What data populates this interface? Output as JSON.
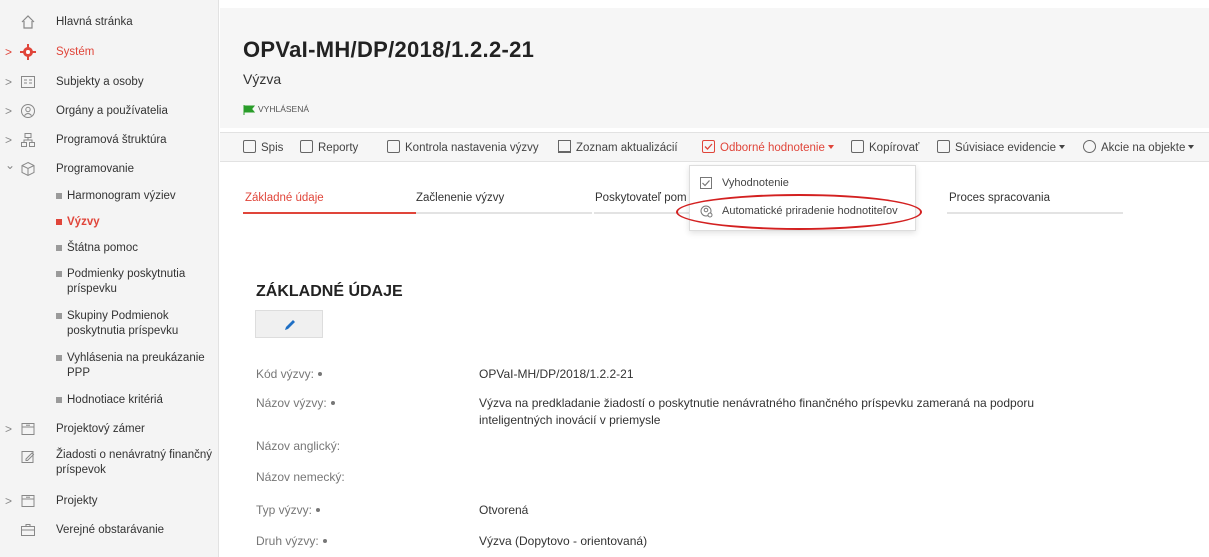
{
  "sidebar": {
    "items": [
      {
        "label": "Hlavná stránka",
        "chevron": "",
        "icon": "home-icon"
      },
      {
        "label": "Systém",
        "chevron": ">",
        "icon": "gear-icon"
      },
      {
        "label": "Subjekty a osoby",
        "chevron": ">",
        "icon": "id-card-icon"
      },
      {
        "label": "Orgány a používatelia",
        "chevron": ">",
        "icon": "user-circle-icon"
      },
      {
        "label": "Programová štruktúra",
        "chevron": ">",
        "icon": "hierarchy-icon"
      },
      {
        "label": "Programovanie",
        "chevron": "⌄",
        "icon": "cube-icon"
      },
      {
        "label": "Projektový zámer",
        "chevron": ">",
        "icon": "folder-icon"
      },
      {
        "label": "Žiadosti o nenávratný finančný príspevok",
        "chevron": "",
        "icon": "edit-doc-icon"
      },
      {
        "label": "Projekty",
        "chevron": ">",
        "icon": "folder-icon"
      },
      {
        "label": "Verejné obstarávanie",
        "chevron": "",
        "icon": "briefcase-icon"
      }
    ],
    "subitems": [
      {
        "label": "Harmonogram výziev"
      },
      {
        "label": "Výzvy"
      },
      {
        "label": "Štátna pomoc"
      },
      {
        "label": "Podmienky poskytnutia príspevku"
      },
      {
        "label": "Skupiny Podmienok poskytnutia príspevku"
      },
      {
        "label": "Vyhlásenia na preukázanie PPP"
      },
      {
        "label": "Hodnotiace kritériá"
      }
    ]
  },
  "header": {
    "title": "OPVaI-MH/DP/2018/1.2.2-21",
    "subtitle": "Výzva",
    "status": "VYHLÁSENÁ",
    "status_color": "#2a9d2a"
  },
  "toolbar": {
    "items": [
      {
        "label": "Spis",
        "icon": "folder-icon"
      },
      {
        "label": "Reporty",
        "icon": "monitor-icon"
      },
      {
        "label": "Kontrola nastavenia výzvy",
        "icon": "checklist-icon"
      },
      {
        "label": "Zoznam aktualizácií",
        "icon": "printer-icon"
      },
      {
        "label": "Odborné hodnotenie",
        "icon": "checkbox-icon"
      },
      {
        "label": "Kopírovať",
        "icon": "copy-icon"
      },
      {
        "label": "Súvisiace evidencie",
        "icon": "link-icon"
      },
      {
        "label": "Akcie na objekte",
        "icon": "gear-icon"
      }
    ]
  },
  "dropdown": {
    "items": [
      {
        "label": "Vyhodnotenie",
        "icon": "checkbox-icon"
      },
      {
        "label": "Automatické priradenie hodnotiteľov",
        "icon": "user-gear-icon"
      }
    ]
  },
  "tabs": [
    {
      "label": "Základné údaje"
    },
    {
      "label": "Začlenenie výzvy"
    },
    {
      "label": "Poskytovateľ pom"
    },
    {
      "label": "Proces spracovania"
    }
  ],
  "section": {
    "title": "ZÁKLADNÉ ÚDAJE",
    "fields": [
      {
        "label": "Kód výzvy:",
        "required": true,
        "value": "OPVaI-MH/DP/2018/1.2.2-21"
      },
      {
        "label": "Názov výzvy:",
        "required": true,
        "value": "Výzva na predkladanie žiadostí o poskytnutie nenávratného finančného príspevku zameraná na podporu inteligentných inovácií v priemysle"
      },
      {
        "label": "Názov anglický:",
        "required": false,
        "value": ""
      },
      {
        "label": "Názov nemecký:",
        "required": false,
        "value": ""
      },
      {
        "label": "Typ výzvy:",
        "required": true,
        "value": "Otvorená"
      },
      {
        "label": "Druh výzvy:",
        "required": true,
        "value": "Výzva (Dopytovo - orientovaná)"
      }
    ]
  },
  "colors": {
    "accent": "#e0453a",
    "highlight": "#d32020"
  }
}
